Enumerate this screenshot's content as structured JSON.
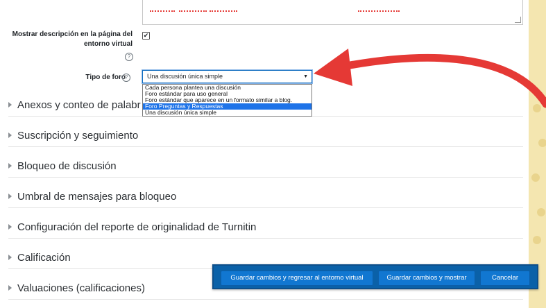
{
  "form": {
    "show_description_label": "Mostrar descripción en la página del entorno virtual",
    "show_description_label_line1": "Mostrar descripción en la página del",
    "show_description_label_line2": "entorno virtual",
    "show_description_checked": true,
    "forum_type_label": "Tipo de foro",
    "forum_type_selected": "Una discusión única simple",
    "forum_type_options": [
      "Cada persona plantea una discusión",
      "Foro estándar para uso general",
      "Foro estándar que aparece en un formato similar a blog.",
      "Foro Preguntas y Respuestas",
      "Una discusión única simple"
    ],
    "highlighted_option_index": 3
  },
  "sections": [
    {
      "label": "Anexos y conteo de palabr"
    },
    {
      "label": "Suscripción y seguimiento"
    },
    {
      "label": "Bloqueo de discusión"
    },
    {
      "label": "Umbral de mensajes para bloqueo"
    },
    {
      "label": "Configuración del reporte de originalidad de Turnitin"
    },
    {
      "label": "Calificación"
    },
    {
      "label": "Valuaciones (calificaciones)"
    }
  ],
  "buttons": {
    "save_return": "Guardar cambios y regresar al entorno virtual",
    "save_show": "Guardar cambios y mostrar",
    "cancel": "Cancelar"
  },
  "colors": {
    "primary": "#0f6cbf",
    "annotation_arrow": "#e53935",
    "highlight": "#1e73e8"
  },
  "icons": {
    "help": "question-circle-icon",
    "section_toggle": "caret-right-icon",
    "select_arrow": "caret-down-icon",
    "annotation": "curved-arrow-icon"
  }
}
